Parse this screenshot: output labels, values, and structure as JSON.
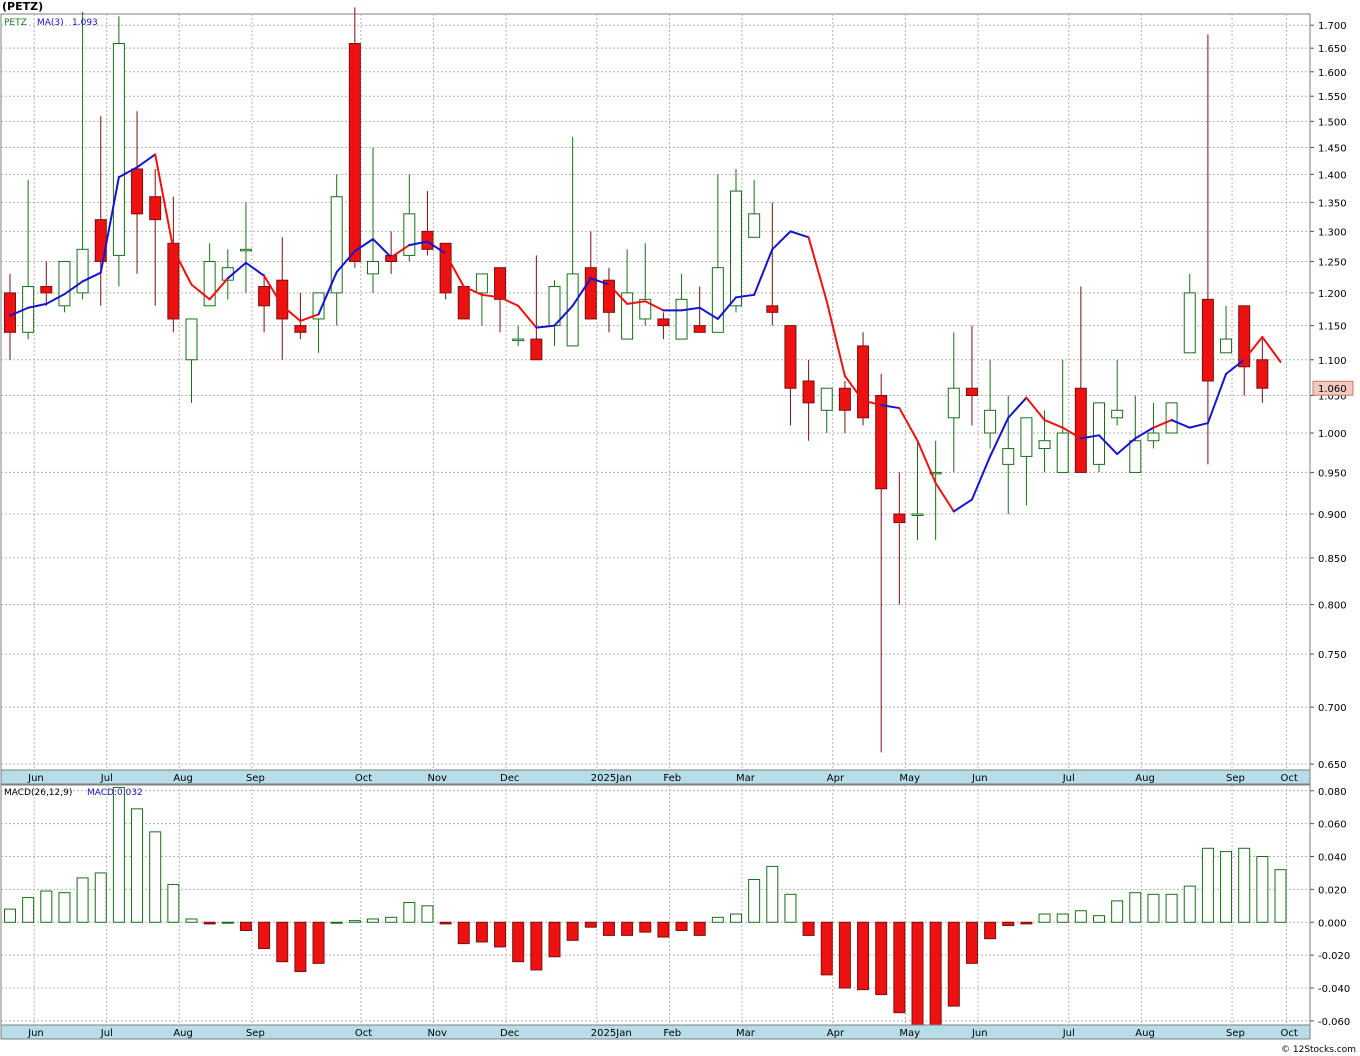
{
  "header": {
    "title": "(PETZ)"
  },
  "footer": {
    "credit": "© 12Stocks.com"
  },
  "chart_data": [
    {
      "type": "candlestick",
      "legend": {
        "symbol": "PETZ",
        "ma_label": "MA(3)",
        "ma_value": "1.093"
      },
      "last_price_label": "1.060",
      "y_ticks": [
        0.65,
        0.7,
        0.75,
        0.8,
        0.85,
        0.9,
        0.95,
        1.0,
        1.05,
        1.1,
        1.15,
        1.2,
        1.25,
        1.3,
        1.35,
        1.4,
        1.45,
        1.5,
        1.55,
        1.6,
        1.65,
        1.7
      ],
      "y_tick_labels": [
        "0.650",
        "0.700",
        "0.750",
        "0.800",
        "0.850",
        "0.900",
        "0.950",
        "1.000",
        "1.050",
        "1.100",
        "1.150",
        "1.200",
        "1.250",
        "1.300",
        "1.350",
        "1.400",
        "1.450",
        "1.500",
        "1.550",
        "1.600",
        "1.650",
        "1.700"
      ],
      "y_scale": "log",
      "ylim": [
        0.645,
        1.725
      ],
      "x_labels": [
        "Jun",
        "Jul",
        "Aug",
        "Sep",
        "Oct",
        "Nov",
        "Dec",
        "2025Jan",
        "Feb",
        "Mar",
        "Apr",
        "May",
        "Jun",
        "Jul",
        "Aug",
        "Sep",
        "Oct"
      ],
      "x_label_weeks": [
        1,
        5,
        9,
        13,
        19,
        23,
        27,
        32,
        36,
        40,
        45,
        49,
        53,
        58,
        62,
        67,
        70
      ],
      "candles": [
        [
          1.2,
          1.23,
          1.1,
          1.14
        ],
        [
          1.14,
          1.39,
          1.13,
          1.21
        ],
        [
          1.21,
          1.25,
          1.18,
          1.2
        ],
        [
          1.18,
          1.25,
          1.17,
          1.25
        ],
        [
          1.2,
          1.73,
          1.19,
          1.27
        ],
        [
          1.32,
          1.51,
          1.18,
          1.25
        ],
        [
          1.26,
          1.72,
          1.21,
          1.66
        ],
        [
          1.41,
          1.52,
          1.23,
          1.33
        ],
        [
          1.36,
          1.41,
          1.18,
          1.32
        ],
        [
          1.28,
          1.36,
          1.14,
          1.16
        ],
        [
          1.1,
          1.16,
          1.04,
          1.16
        ],
        [
          1.18,
          1.28,
          1.2,
          1.25
        ],
        [
          1.22,
          1.27,
          1.19,
          1.24
        ],
        [
          1.27,
          1.35,
          1.2,
          1.27
        ],
        [
          1.21,
          1.23,
          1.14,
          1.18
        ],
        [
          1.22,
          1.29,
          1.1,
          1.16
        ],
        [
          1.15,
          1.2,
          1.13,
          1.14
        ],
        [
          1.16,
          1.2,
          1.11,
          1.2
        ],
        [
          1.2,
          1.4,
          1.15,
          1.36
        ],
        [
          1.66,
          1.74,
          1.24,
          1.25
        ],
        [
          1.23,
          1.45,
          1.2,
          1.25
        ],
        [
          1.26,
          1.3,
          1.23,
          1.25
        ],
        [
          1.26,
          1.4,
          1.25,
          1.33
        ],
        [
          1.3,
          1.37,
          1.26,
          1.27
        ],
        [
          1.28,
          1.28,
          1.19,
          1.2
        ],
        [
          1.21,
          1.21,
          1.16,
          1.16
        ],
        [
          1.2,
          1.23,
          1.15,
          1.23
        ],
        [
          1.24,
          1.24,
          1.14,
          1.19
        ],
        [
          1.13,
          1.15,
          1.12,
          1.13
        ],
        [
          1.13,
          1.26,
          1.1,
          1.1
        ],
        [
          1.15,
          1.22,
          1.12,
          1.21
        ],
        [
          1.12,
          1.47,
          1.12,
          1.23
        ],
        [
          1.24,
          1.3,
          1.16,
          1.16
        ],
        [
          1.22,
          1.24,
          1.14,
          1.17
        ],
        [
          1.13,
          1.27,
          1.13,
          1.2
        ],
        [
          1.16,
          1.28,
          1.15,
          1.19
        ],
        [
          1.16,
          1.17,
          1.13,
          1.15
        ],
        [
          1.13,
          1.23,
          1.13,
          1.19
        ],
        [
          1.15,
          1.21,
          1.14,
          1.14
        ],
        [
          1.14,
          1.4,
          1.14,
          1.24
        ],
        [
          1.18,
          1.41,
          1.17,
          1.37
        ],
        [
          1.29,
          1.39,
          1.29,
          1.33
        ],
        [
          1.18,
          1.35,
          1.15,
          1.17
        ],
        [
          1.15,
          1.15,
          1.01,
          1.06
        ],
        [
          1.07,
          1.1,
          0.99,
          1.04
        ],
        [
          1.03,
          1.06,
          1.0,
          1.06
        ],
        [
          1.06,
          1.07,
          1.0,
          1.03
        ],
        [
          1.12,
          1.14,
          1.01,
          1.02
        ],
        [
          1.05,
          1.08,
          0.66,
          0.93
        ],
        [
          0.9,
          0.95,
          0.8,
          0.89
        ],
        [
          0.9,
          0.99,
          0.87,
          0.9
        ],
        [
          0.95,
          0.99,
          0.87,
          0.95
        ],
        [
          1.02,
          1.14,
          0.95,
          1.06
        ],
        [
          1.06,
          1.15,
          1.01,
          1.05
        ],
        [
          1.0,
          1.1,
          0.98,
          1.03
        ],
        [
          0.96,
          1.05,
          0.9,
          0.98
        ],
        [
          0.97,
          1.02,
          0.91,
          1.02
        ],
        [
          0.98,
          1.03,
          0.95,
          0.99
        ],
        [
          0.95,
          1.1,
          0.95,
          1.0
        ],
        [
          1.06,
          1.21,
          0.95,
          0.95
        ],
        [
          0.96,
          1.04,
          0.95,
          1.04
        ],
        [
          1.02,
          1.1,
          1.01,
          1.03
        ],
        [
          0.95,
          1.05,
          0.95,
          0.99
        ],
        [
          0.99,
          1.04,
          0.98,
          1.0
        ],
        [
          1.0,
          1.04,
          1.0,
          1.04
        ],
        [
          1.11,
          1.23,
          1.11,
          1.2
        ],
        [
          1.19,
          1.68,
          0.96,
          1.07
        ],
        [
          1.11,
          1.18,
          1.11,
          1.13
        ],
        [
          1.18,
          1.18,
          1.05,
          1.09
        ],
        [
          1.1,
          1.13,
          1.04,
          1.06
        ]
      ],
      "ma3": [
        1.165,
        1.177,
        1.183,
        1.198,
        1.218,
        1.232,
        1.395,
        1.413,
        1.437,
        1.27,
        1.213,
        1.19,
        1.223,
        1.248,
        1.227,
        1.18,
        1.157,
        1.167,
        1.233,
        1.267,
        1.287,
        1.257,
        1.277,
        1.283,
        1.263,
        1.21,
        1.197,
        1.193,
        1.18,
        1.147,
        1.15,
        1.18,
        1.223,
        1.213,
        1.183,
        1.187,
        1.173,
        1.173,
        1.177,
        1.16,
        1.193,
        1.197,
        1.27,
        1.3,
        1.29,
        1.187,
        1.077,
        1.043,
        1.037,
        1.033,
        0.99,
        0.937,
        0.903,
        0.917,
        0.97,
        1.02,
        1.047,
        1.017,
        1.007,
        0.993,
        0.997,
        0.973,
        0.993,
        1.007,
        1.017,
        1.007,
        1.013,
        1.08,
        1.1,
        1.133,
        1.097
      ],
      "ma_dir": [
        "b",
        "b",
        "b",
        "b",
        "b",
        "b",
        "b",
        "b",
        "r",
        "r",
        "r",
        "r",
        "b",
        "b",
        "r",
        "r",
        "r",
        "b",
        "b",
        "b",
        "b",
        "r",
        "b",
        "b",
        "r",
        "r",
        "r",
        "r",
        "r",
        "b",
        "b",
        "b",
        "b",
        "r",
        "r",
        "r",
        "b",
        "b",
        "b",
        "b",
        "b",
        "b",
        "b",
        "b",
        "r",
        "r",
        "r",
        "r",
        "b",
        "r",
        "r",
        "r",
        "b",
        "b",
        "b",
        "b",
        "r",
        "r",
        "r",
        "b",
        "b",
        "b",
        "b",
        "r",
        "b",
        "b",
        "b",
        "b",
        "r",
        "r"
      ],
      "macd_legend": {
        "name": "MACD(26,12,9)",
        "value_label": "MACD:0.032"
      },
      "macd_ticks": [
        -0.06,
        -0.04,
        -0.02,
        0.0,
        0.02,
        0.04,
        0.06,
        0.08
      ],
      "macd_tick_labels": [
        "-0.060",
        "-0.040",
        "-0.020",
        "0.000",
        "0.020",
        "0.040",
        "0.060",
        "0.080"
      ],
      "macd_ylim": [
        -0.0625,
        0.0835
      ],
      "macd": [
        0.008,
        0.015,
        0.019,
        0.018,
        0.027,
        0.03,
        0.082,
        0.069,
        0.055,
        0.023,
        0.002,
        -0.001,
        0.0,
        -0.005,
        -0.016,
        -0.024,
        -0.03,
        -0.025,
        0.0,
        0.001,
        0.002,
        0.003,
        0.012,
        0.01,
        -0.001,
        -0.013,
        -0.012,
        -0.015,
        -0.024,
        -0.029,
        -0.021,
        -0.011,
        -0.003,
        -0.008,
        -0.008,
        -0.006,
        -0.009,
        -0.005,
        -0.008,
        0.003,
        0.005,
        0.026,
        0.034,
        0.017,
        -0.008,
        -0.032,
        -0.04,
        -0.041,
        -0.044,
        -0.055,
        -0.064,
        -0.064,
        -0.051,
        -0.025,
        -0.01,
        -0.002,
        -0.001,
        0.005,
        0.005,
        0.007,
        0.004,
        0.013,
        0.018,
        0.017,
        0.017,
        0.022,
        0.045,
        0.043,
        0.045,
        0.04,
        0.032
      ]
    }
  ]
}
